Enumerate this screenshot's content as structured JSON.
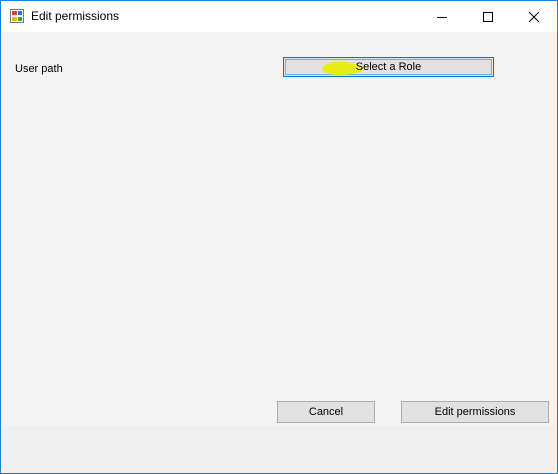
{
  "window": {
    "title": "Edit permissions",
    "accent_color": "#1883d7",
    "controls": {
      "minimize_icon": "minimize-icon",
      "maximize_icon": "maximize-icon",
      "close_icon": "close-icon"
    }
  },
  "form": {
    "user_path_label": "User path",
    "select_role_button": "Select a Role",
    "highlight_color": "#e8f000"
  },
  "footer": {
    "cancel_label": "Cancel",
    "edit_permissions_label": "Edit permissions"
  }
}
